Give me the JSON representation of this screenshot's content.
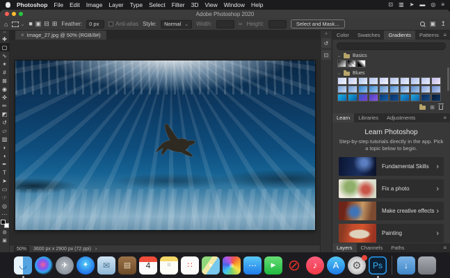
{
  "menubar": {
    "items": [
      {
        "label": "Photoshop",
        "bold": true
      },
      {
        "label": "File"
      },
      {
        "label": "Edit"
      },
      {
        "label": "Image"
      },
      {
        "label": "Layer"
      },
      {
        "label": "Type"
      },
      {
        "label": "Select"
      },
      {
        "label": "Filter"
      },
      {
        "label": "3D"
      },
      {
        "label": "View"
      },
      {
        "label": "Window"
      },
      {
        "label": "Help"
      }
    ],
    "status_icons": [
      {
        "name": "screen-mirroring-icon",
        "glyph": "⊡"
      },
      {
        "name": "display-icon",
        "glyph": "▥"
      },
      {
        "name": "location-icon",
        "glyph": "➤"
      },
      {
        "name": "battery-icon",
        "glyph": "▬"
      },
      {
        "name": "spotlight-icon",
        "glyph": "◎"
      },
      {
        "name": "control-center-icon",
        "glyph": "≡"
      }
    ]
  },
  "titlebar": {
    "title": "Adobe Photoshop 2020"
  },
  "options": {
    "home_glyph": "⌂",
    "caret": "⌄",
    "modes": [
      {
        "name": "new-selection-icon",
        "glyph": "■"
      },
      {
        "name": "add-selection-icon",
        "glyph": "▣"
      },
      {
        "name": "subtract-selection-icon",
        "glyph": "⊟"
      },
      {
        "name": "intersect-selection-icon",
        "glyph": "⊞"
      }
    ],
    "feather_label": "Feather:",
    "feather_value": "0 px",
    "antialias_label": "Anti-alias",
    "style_label": "Style:",
    "style_value": "Normal",
    "width_label": "Width:",
    "link_glyph": "∞",
    "height_label": "Height:",
    "select_mask_label": "Select and Mask...",
    "workspace_glyph": "▣",
    "share_glyph": "↥"
  },
  "tools": {
    "items": [
      {
        "name": "move-tool",
        "glyph": "✚"
      },
      {
        "name": "marquee-tool",
        "glyph": "▢",
        "active": true
      },
      {
        "name": "lasso-tool",
        "glyph": "∿"
      },
      {
        "name": "quick-selection-tool",
        "glyph": "✶"
      },
      {
        "name": "crop-tool",
        "glyph": "#"
      },
      {
        "name": "frame-tool",
        "glyph": "⊠"
      },
      {
        "name": "eyedropper-tool",
        "glyph": "◉"
      },
      {
        "name": "healing-brush-tool",
        "glyph": "✜"
      },
      {
        "name": "brush-tool",
        "glyph": "✏"
      },
      {
        "name": "clone-stamp-tool",
        "glyph": "◩"
      },
      {
        "name": "history-brush-tool",
        "glyph": "↺"
      },
      {
        "name": "eraser-tool",
        "glyph": "▱"
      },
      {
        "name": "gradient-tool",
        "glyph": "▨"
      },
      {
        "name": "blur-tool",
        "glyph": "◗"
      },
      {
        "name": "dodge-tool",
        "glyph": "◖"
      },
      {
        "name": "pen-tool",
        "glyph": "✒"
      },
      {
        "name": "type-tool",
        "glyph": "T"
      },
      {
        "name": "path-selection-tool",
        "glyph": "➤"
      },
      {
        "name": "shape-tool",
        "glyph": "▭"
      },
      {
        "name": "hand-tool",
        "glyph": "☞"
      },
      {
        "name": "zoom-tool",
        "glyph": "◎"
      },
      {
        "name": "more-tools",
        "glyph": "⋯"
      }
    ],
    "foreground_color": "#000000",
    "background_color": "#ffffff",
    "quick_mask_glyph": "◍",
    "screen_mode_glyph": "▣"
  },
  "document": {
    "tab_label": "Image_27.jpg @ 50% (RGB/8#)",
    "close_glyph": "×",
    "zoom_level": "50%",
    "dimensions": "3600 px x 2900 px (72 ppi)",
    "chevron": "›"
  },
  "collapsed_dock": {
    "arrows": "«",
    "icons": [
      {
        "name": "history-panel-icon",
        "glyph": "↺"
      },
      {
        "name": "comments-panel-icon",
        "glyph": "⊡"
      }
    ]
  },
  "panels": {
    "color_tabs": [
      {
        "label": "Color"
      },
      {
        "label": "Swatches"
      },
      {
        "label": "Gradients",
        "active": true
      },
      {
        "label": "Patterns"
      }
    ],
    "menu_icon": "≡",
    "gradients": {
      "group_caret": "⌄",
      "basics_label": "Basics",
      "basics_swatches": [
        {
          "bg": "linear-gradient(135deg,#111111,#f5f5f5)"
        },
        {
          "bg": "linear-gradient(135deg,#000000 10%,rgba(0,0,0,0) 75%), repeating-linear-gradient(45deg,#c8c8c8 0 2px,#ffffff 2px 4px)"
        },
        {
          "bg": "linear-gradient(45deg,#000000 30%,#ffffff 70%)"
        }
      ],
      "blues_label": "Blues",
      "blues_swatches": [
        {
          "bg": "linear-gradient(135deg,#c8d2f2,#f2f5ff)"
        },
        {
          "bg": "linear-gradient(135deg,#bcc8ee,#eef1fb)"
        },
        {
          "bg": "linear-gradient(135deg,#aec2ea,#e8eefc)"
        },
        {
          "bg": "linear-gradient(135deg,#b6c6f0,#dfe8fb)"
        },
        {
          "bg": "linear-gradient(135deg,#c4cef2,#f5f7ff)"
        },
        {
          "bg": "linear-gradient(135deg,#b2c2ec,#e6edfb)"
        },
        {
          "bg": "linear-gradient(135deg,#bac8f0,#eef3fe)"
        },
        {
          "bg": "linear-gradient(135deg,#aabcea,#dce6f8)"
        },
        {
          "bg": "linear-gradient(135deg,#b8c4ee,#eaeffc)"
        },
        {
          "bg": "linear-gradient(135deg,#c0b8e8,#efeaf8)"
        },
        {
          "bg": "linear-gradient(135deg,#7aa2d8,#c6d8f0)"
        },
        {
          "bg": "linear-gradient(135deg,#6f9ad4,#bcd2ee)"
        },
        {
          "bg": "linear-gradient(135deg,#2f7fd0,#8fc0ea)"
        },
        {
          "bg": "linear-gradient(135deg,#3a86d4,#9cc8ee)"
        },
        {
          "bg": "linear-gradient(135deg,#5f92d0,#b2cdec)"
        },
        {
          "bg": "linear-gradient(135deg,#4a8cd6,#a6c9ec)"
        },
        {
          "bg": "linear-gradient(135deg,#6c9ede,#cddff4)"
        },
        {
          "bg": "linear-gradient(135deg,#5688cc,#aac6e8)"
        },
        {
          "bg": "linear-gradient(135deg,#7e9ede,#d0dcf2)"
        },
        {
          "bg": "linear-gradient(135deg,#6a8ad0,#b8c8ec)"
        },
        {
          "bg": "linear-gradient(135deg,#17b2e8,#0c6cb4)"
        },
        {
          "bg": "linear-gradient(135deg,#0fa6e0,#0a5aa0)"
        },
        {
          "bg": "linear-gradient(135deg,#2f56c8,#7a3fd0)"
        },
        {
          "bg": "linear-gradient(135deg,#4a3fc0,#8a5ae0)"
        },
        {
          "bg": "linear-gradient(135deg,#0c3a78,#1560a8)"
        },
        {
          "bg": "linear-gradient(135deg,#0a2f66,#0f4f92)"
        },
        {
          "bg": "linear-gradient(135deg,#1b98d8,#0d5ca6)"
        },
        {
          "bg": "linear-gradient(135deg,#25aade,#0e62aa)"
        },
        {
          "bg": "linear-gradient(135deg,#0d2c58,#144a86)"
        },
        {
          "bg": "linear-gradient(135deg,#081a36,#0d3564)"
        }
      ],
      "new_group_glyph": "⊞"
    },
    "learn": {
      "tabs": [
        {
          "label": "Learn",
          "active": true
        },
        {
          "label": "Libraries"
        },
        {
          "label": "Adjustments"
        }
      ],
      "title": "Learn Photoshop",
      "desc": "Step-by-step tutorials directly in the app. Pick a topic below to begin.",
      "chevron": "›",
      "items": [
        {
          "name": "tutorial-fundamental-skills",
          "label": "Fundamental Skills",
          "thumb": "radial-gradient(circle at 68% 30%, #5a7ec0 0 10%, rgba(90,126,192,0) 38%), linear-gradient(100deg, #0b1430, #1a2f5e 55%, #0a1128)"
        },
        {
          "name": "tutorial-fix-a-photo",
          "label": "Fix a photo",
          "thumb": "radial-gradient(circle at 72% 55%, #c85648 0 12%, rgba(200,86,72,0) 34%), radial-gradient(circle at 30% 40%, #8faf6a 0 16%, rgba(143,175,106,0) 42%), linear-gradient(100deg, #efe9dc, #f6f3ea 50%, #cfd6c0)"
        },
        {
          "name": "tutorial-make-creative-effects",
          "label": "Make creative effects",
          "thumb": "radial-gradient(circle at 42% 55%, #3f74b8 0 14%, rgba(63,116,184,0) 40%), linear-gradient(100deg, #6e2418 0 18%, #a35a2e 38%, #c89a66 60%, #7c4a30 85%)"
        },
        {
          "name": "tutorial-painting",
          "label": "Painting",
          "thumb": "radial-gradient(ellipse 40% 35% at 55% 55%, #ded2bc 0 60%, rgba(222,210,188,0) 75%), linear-gradient(100deg, #8a3a22 0 12%, #c44a2c 35%, #d2552e 60%, #9c3422 90%)"
        }
      ]
    },
    "bottom_tabs": [
      {
        "label": "Layers",
        "active": true
      },
      {
        "label": "Channels"
      },
      {
        "label": "Paths"
      }
    ]
  },
  "dock": {
    "apps": [
      {
        "name": "dock-finder",
        "glyph": "◡",
        "fg": "#1a5e9e",
        "bg": "linear-gradient(90deg,#e8f4fc 0 50%,#53a4e0 50%)",
        "dot": true
      },
      {
        "name": "dock-siri",
        "glyph": "",
        "bg": "radial-gradient(circle at 45% 45%, #f0609a, #8455f0 30%, #2ca8f0 55%, #15151f 75%)",
        "circle": true
      },
      {
        "name": "dock-launchpad",
        "glyph": "✈",
        "fg": "#ffffff",
        "fs": "11px",
        "bg": "radial-gradient(circle,#b8bec6,#787e88)",
        "circle": true
      },
      {
        "name": "dock-safari",
        "glyph": "✦",
        "fg": "#ffffff",
        "fs": "10px",
        "bg": "radial-gradient(circle at 50% 40%,#5ad2f8,#1c6ee8 75%)",
        "circle": true
      },
      {
        "name": "dock-mail",
        "glyph": "✉",
        "fg": "#49708e",
        "fs": "12px",
        "bg": "linear-gradient(180deg,#cfe3f2,#8fb8d8)"
      },
      {
        "name": "dock-contacts",
        "glyph": "▤",
        "fg": "#e8d8b8",
        "fs": "11px",
        "bg": "linear-gradient(180deg,#9a7248,#6e4a28)"
      },
      {
        "name": "dock-calendar",
        "glyph": "4",
        "fg": "#333333",
        "fs": "12px",
        "bg": "linear-gradient(180deg,#ef4d3a 0 30%,#fbfbfb 30%)"
      },
      {
        "name": "dock-notes",
        "glyph": "≡",
        "fg": "#c0c0b8",
        "fs": "10px",
        "bg": "linear-gradient(180deg,#f6d96a 0 26%,#fdfdf8 26%)"
      },
      {
        "name": "dock-reminders",
        "glyph": "∷",
        "fg": "#e8453a",
        "fs": "11px",
        "bg": "#fbfbfb"
      },
      {
        "name": "dock-maps",
        "glyph": "➤",
        "fg": "#ffffff",
        "fs": "8px",
        "bg": "linear-gradient(125deg,#8fd87c 0 35%,#f2e9a8 35% 55%,#79c8ee 55%)"
      },
      {
        "name": "dock-photos",
        "glyph": "",
        "bg": "radial-gradient(circle, rgba(255,255,255,.4) 0 16%, rgba(255,255,255,0) 17%), conic-gradient(from 20deg,#f25749,#f5a528,#f7e04b,#7fd163,#41c6f0,#4a63e8,#b457e8,#f25749)"
      },
      {
        "name": "dock-messages",
        "glyph": "⋯",
        "fg": "#ffffff",
        "fs": "12px",
        "bg": "linear-gradient(180deg,#59c9f7,#1f7ae8)"
      },
      {
        "name": "dock-facetime",
        "glyph": "▶",
        "fg": "#ffffff",
        "fs": "9px",
        "bg": "linear-gradient(180deg,#67de76,#1fb83e)"
      },
      {
        "name": "dock-blocked-app",
        "glyph": "⊘",
        "fg": "#e23028",
        "fs": "22px",
        "bg": "transparent"
      },
      {
        "name": "dock-music",
        "glyph": "♪",
        "fg": "#ffffff",
        "fs": "13px",
        "bg": "linear-gradient(180deg,#fd5e7e,#f03a46)",
        "circle": true
      },
      {
        "name": "dock-app-store",
        "glyph": "A",
        "fg": "#ffffff",
        "fs": "13px",
        "bg": "linear-gradient(180deg,#52c7f5,#1e7ae6)",
        "circle": true
      },
      {
        "name": "dock-system-preferences",
        "glyph": "⚙",
        "fg": "#555555",
        "fs": "15px",
        "bg": "radial-gradient(circle,#e0e0e0 0 35%,#9a9aa0)",
        "circle": true,
        "badge": true
      },
      {
        "name": "dock-photoshop",
        "glyph": "Ps",
        "fg": "#3bb3f8",
        "fs": "12px",
        "bg": "#0c1f33",
        "outlined": true,
        "dot": true
      }
    ],
    "extras": [
      {
        "name": "dock-downloads",
        "glyph": "↓",
        "fg": "#ffffff",
        "fs": "12px",
        "bg": "linear-gradient(180deg,#7cb5e8,#3f86c8)"
      },
      {
        "name": "dock-trash",
        "glyph": "",
        "bg": "linear-gradient(180deg,rgba(215,218,225,.75),rgba(140,144,152,.8))"
      }
    ]
  },
  "colors": {
    "accent_blue": "#31a8ff",
    "chrome": "#3a3a3a",
    "panel": "#383838",
    "pasteboard": "#2b2b2b"
  }
}
